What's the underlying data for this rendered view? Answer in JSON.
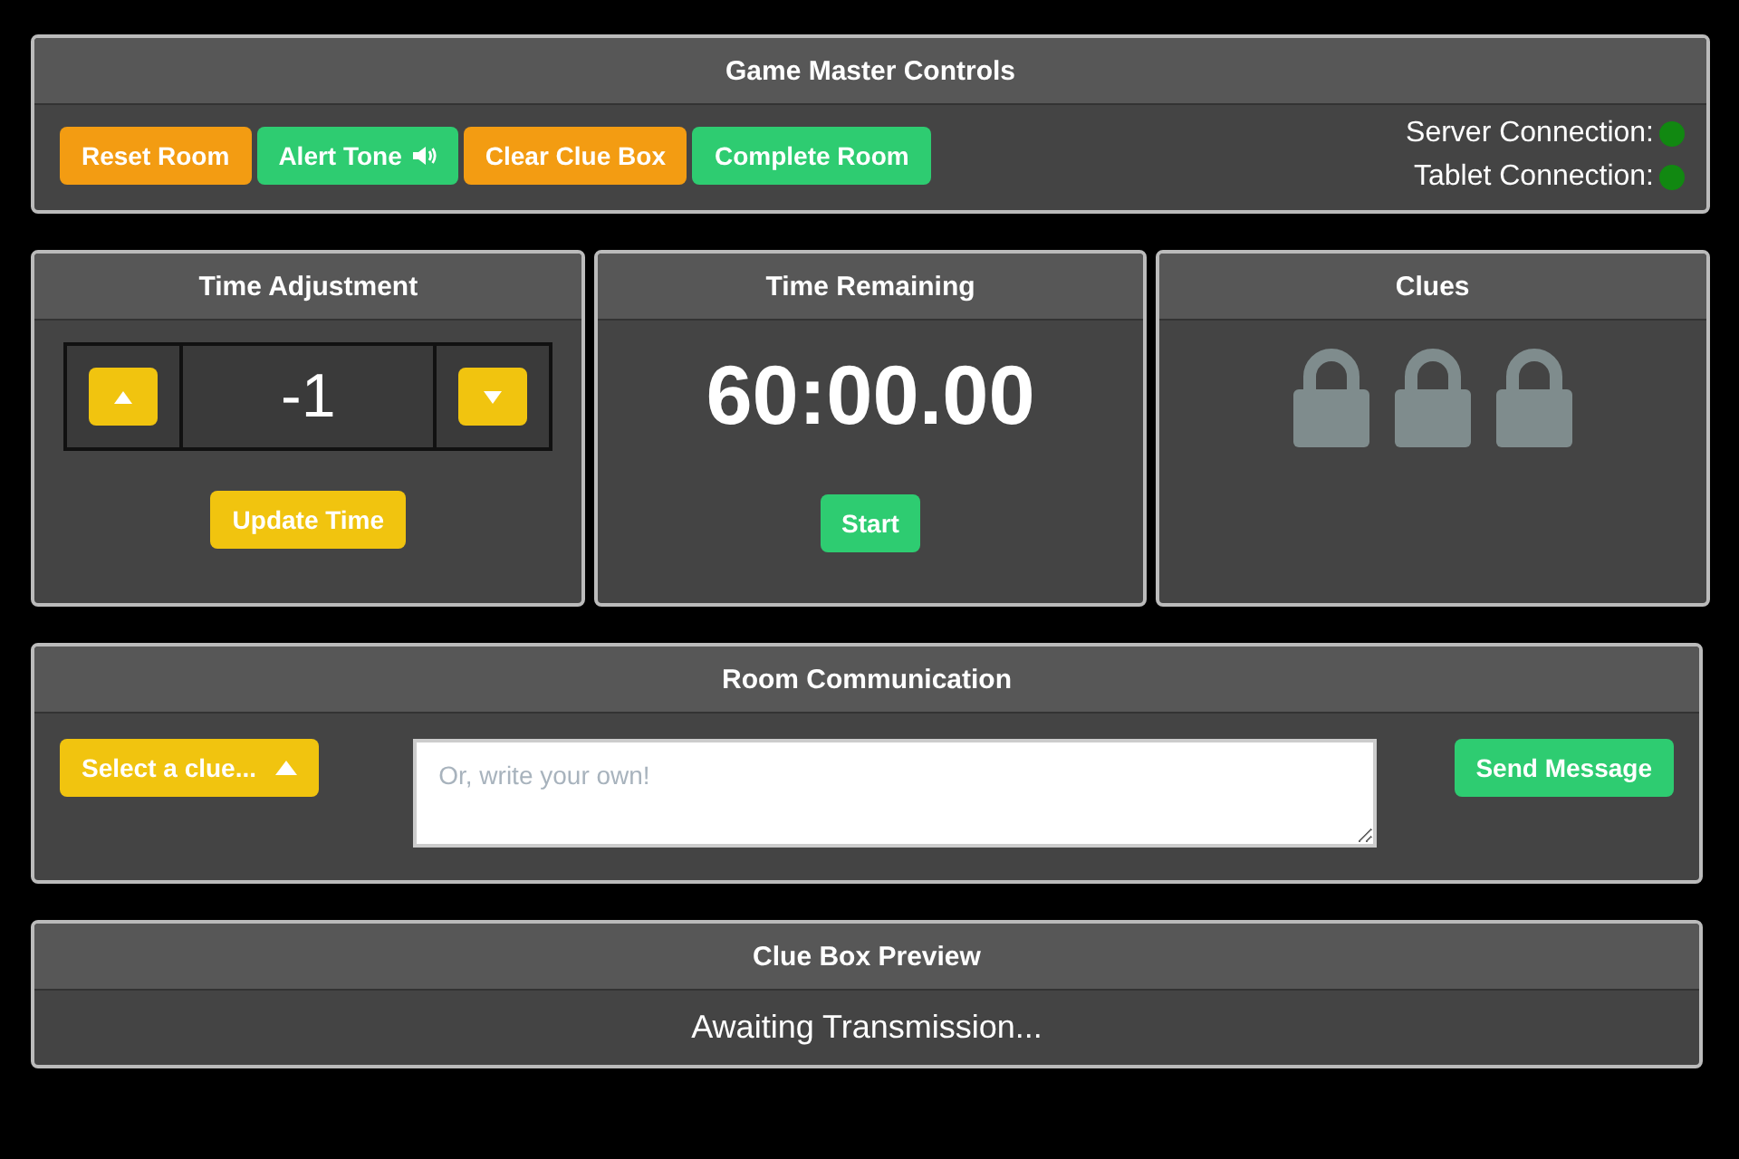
{
  "controls": {
    "title": "Game Master Controls",
    "buttons": [
      {
        "label": "Reset Room",
        "color": "#f39c12",
        "kind": "plain"
      },
      {
        "label": "Alert Tone",
        "color": "#2ecc71",
        "kind": "sound"
      },
      {
        "label": "Clear Clue Box",
        "color": "#f39c12",
        "kind": "plain"
      },
      {
        "label": "Complete Room",
        "color": "#2ecc71",
        "kind": "plain"
      }
    ],
    "connections": [
      {
        "label": "Server Connection:",
        "connected": true
      },
      {
        "label": "Tablet Connection:",
        "connected": true
      }
    ]
  },
  "time_adjustment": {
    "title": "Time Adjustment",
    "value": "-1",
    "button": "Update Time"
  },
  "time_remaining": {
    "title": "Time Remaining",
    "time": "60:00.00",
    "button": "Start"
  },
  "clues": {
    "title": "Clues",
    "items": [
      {
        "locked": true
      },
      {
        "locked": true
      },
      {
        "locked": true
      }
    ]
  },
  "communication": {
    "title": "Room Communication",
    "select": "Select a clue...",
    "message": {
      "placeholder": "Or, write your own!"
    },
    "button": "Send Message"
  },
  "preview": {
    "title": "Clue Box Preview",
    "text": "Awaiting Transmission..."
  }
}
